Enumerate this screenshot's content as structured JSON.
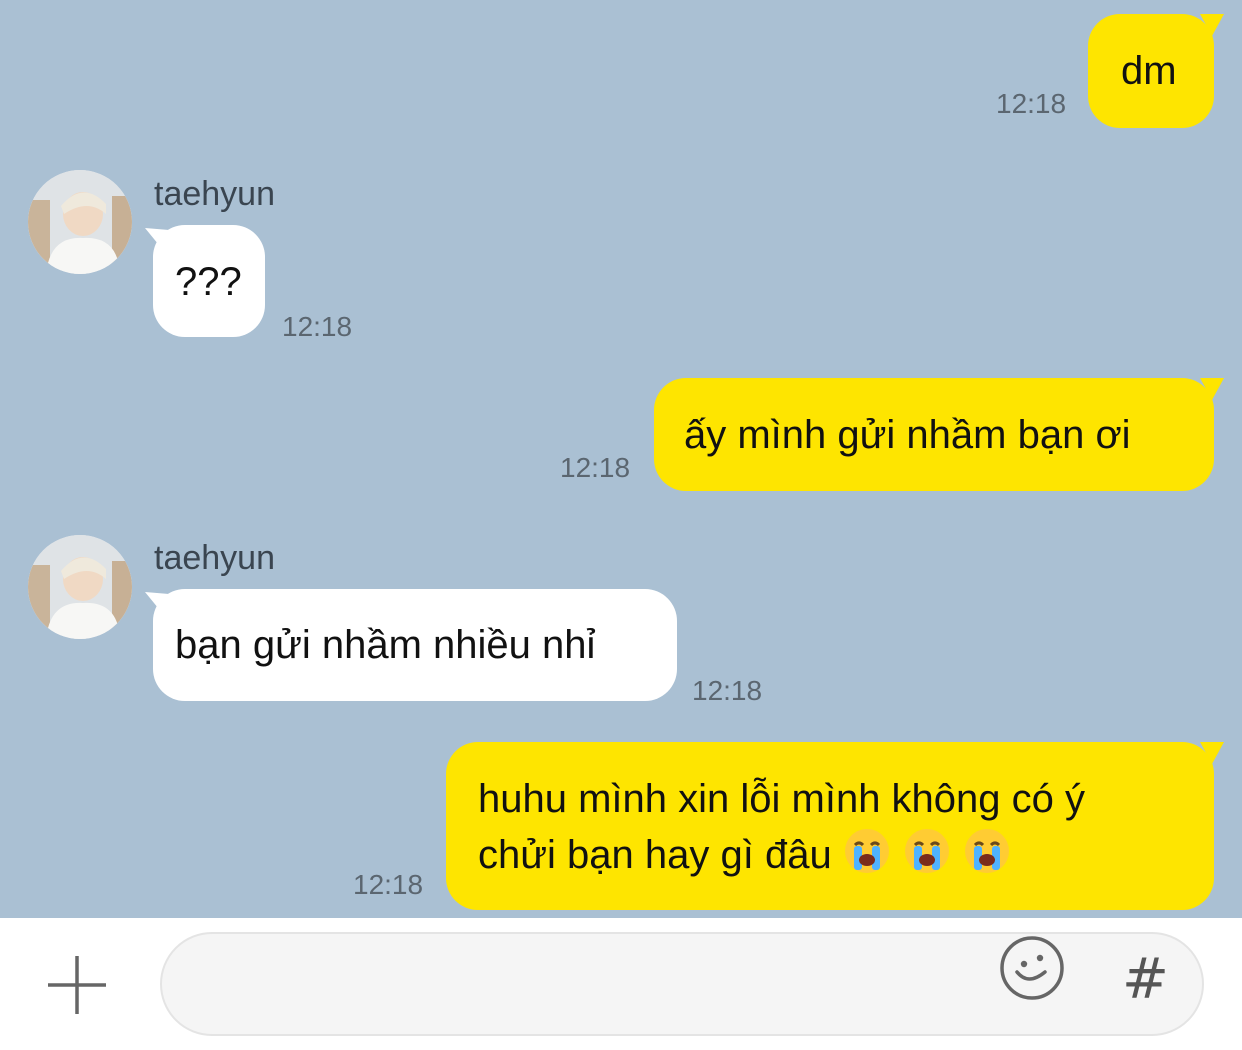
{
  "messages": [
    {
      "sender": "me",
      "text": "dm",
      "time": "12:18"
    },
    {
      "sender": "taehyun",
      "text": "???",
      "time": "12:18"
    },
    {
      "sender": "me",
      "text": "ấy mình gửi nhầm bạn ơi",
      "time": "12:18"
    },
    {
      "sender": "taehyun",
      "text": "bạn gửi nhầm nhiều nhỉ",
      "time": "12:18"
    },
    {
      "sender": "me",
      "lines": [
        "huhu mình xin lỗi mình không có ý",
        "chửi bạn hay gì đâu"
      ],
      "emojis": [
        "loudly-crying-face",
        "loudly-crying-face",
        "loudly-crying-face"
      ],
      "time": "12:18"
    }
  ],
  "contact": {
    "name": "taehyun"
  },
  "input": {
    "value": "",
    "placeholder": ""
  },
  "toolbar": {
    "hash_label": "#"
  },
  "icons": {
    "attach": "plus-icon",
    "emoji": "emoji-icon",
    "hashtag": "hashtag-icon"
  },
  "colors": {
    "background": "#aac0d3",
    "outgoing_bubble": "#fee500",
    "incoming_bubble": "#ffffff",
    "time_text": "#5b6670"
  }
}
